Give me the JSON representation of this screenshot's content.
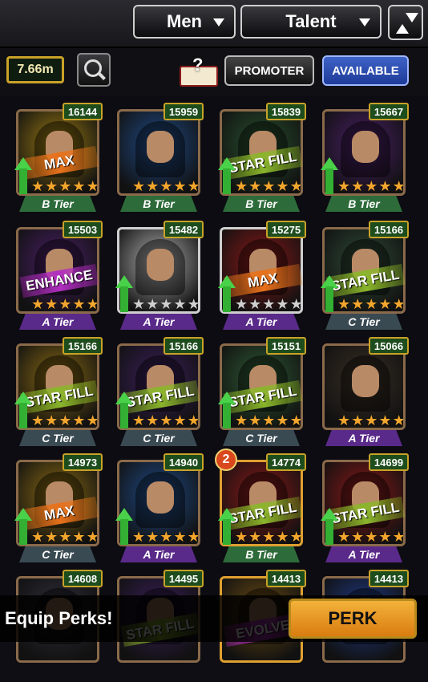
{
  "filters": {
    "gender": "Men",
    "sort": "Talent"
  },
  "toolbar": {
    "coins": "7.66m",
    "promoter_label": "PROMOTER",
    "available_label": "AVAILABLE"
  },
  "rows": [
    [
      {
        "power": "16144",
        "tier": "B Tier",
        "tier_class": "b",
        "banner": "MAX",
        "banner_class": "max",
        "arrow": true,
        "stars": 5,
        "gold": 5,
        "frame": "#8a6a4a",
        "bg": "#9a7a12"
      },
      {
        "power": "15959",
        "tier": "B Tier",
        "tier_class": "b",
        "banner": "",
        "banner_class": "",
        "arrow": false,
        "stars": 5,
        "gold": 5,
        "frame": "#8a6a4a",
        "bg": "#1f4a86"
      },
      {
        "power": "15839",
        "tier": "B Tier",
        "tier_class": "b",
        "banner": "STAR FILL",
        "banner_class": "starfill",
        "arrow": true,
        "stars": 5,
        "gold": 5,
        "frame": "#8a6a4a",
        "bg": "#28502e"
      },
      {
        "power": "15667",
        "tier": "B Tier",
        "tier_class": "b",
        "banner": "",
        "banner_class": "",
        "arrow": true,
        "stars": 5,
        "gold": 5,
        "frame": "#8a6a4a",
        "bg": "#4a1f66"
      }
    ],
    [
      {
        "power": "15503",
        "tier": "A Tier",
        "tier_class": "a",
        "banner": "ENHANCE",
        "banner_class": "enhance",
        "arrow": false,
        "stars": 5,
        "gold": 5,
        "frame": "#8a6a4a",
        "bg": "#4a1f66"
      },
      {
        "power": "15482",
        "tier": "A Tier",
        "tier_class": "a",
        "banner": "",
        "banner_class": "",
        "arrow": true,
        "stars": 5,
        "gold": 0,
        "frame": "#cfcfcf",
        "bg": "#b0b0b0"
      },
      {
        "power": "15275",
        "tier": "A Tier",
        "tier_class": "a",
        "banner": "MAX",
        "banner_class": "max",
        "arrow": true,
        "stars": 5,
        "gold": 0,
        "frame": "#cfcfcf",
        "bg": "#8a1818"
      },
      {
        "power": "15166",
        "tier": "C Tier",
        "tier_class": "c",
        "banner": "STAR FILL",
        "banner_class": "starfill",
        "arrow": true,
        "stars": 5,
        "gold": 5,
        "frame": "#8a6a4a",
        "bg": "#2e4a36"
      }
    ],
    [
      {
        "power": "15166",
        "tier": "C Tier",
        "tier_class": "c",
        "banner": "STAR FILL",
        "banner_class": "starfill",
        "arrow": true,
        "stars": 5,
        "gold": 5,
        "frame": "#8a6a4a",
        "bg": "#8a6a12"
      },
      {
        "power": "15166",
        "tier": "C Tier",
        "tier_class": "c",
        "banner": "STAR FILL",
        "banner_class": "starfill",
        "arrow": true,
        "stars": 5,
        "gold": 5,
        "frame": "#8a6a4a",
        "bg": "#3a1f5a"
      },
      {
        "power": "15151",
        "tier": "C Tier",
        "tier_class": "c",
        "banner": "STAR FILL",
        "banner_class": "starfill",
        "arrow": true,
        "stars": 5,
        "gold": 5,
        "frame": "#8a6a4a",
        "bg": "#2e5a34"
      },
      {
        "power": "15066",
        "tier": "A Tier",
        "tier_class": "a",
        "banner": "",
        "banner_class": "",
        "arrow": false,
        "stars": 5,
        "gold": 5,
        "frame": "#8a6a4a",
        "bg": "#3a2e24"
      }
    ],
    [
      {
        "power": "14973",
        "tier": "C Tier",
        "tier_class": "c",
        "banner": "MAX",
        "banner_class": "max",
        "arrow": true,
        "stars": 5,
        "gold": 5,
        "frame": "#8a6a4a",
        "bg": "#8a6a12"
      },
      {
        "power": "14940",
        "tier": "A Tier",
        "tier_class": "a",
        "banner": "",
        "banner_class": "",
        "arrow": true,
        "stars": 5,
        "gold": 5,
        "frame": "#8a6a4a",
        "bg": "#1f4a86"
      },
      {
        "power": "14774",
        "tier": "B Tier",
        "tier_class": "b",
        "banner": "STAR FILL",
        "banner_class": "starfill",
        "arrow": true,
        "stars": 5,
        "gold": 5,
        "frame": "#e0a030",
        "bg": "#8a1818",
        "badge": "2"
      },
      {
        "power": "14699",
        "tier": "A Tier",
        "tier_class": "a",
        "banner": "STAR FILL",
        "banner_class": "starfill",
        "arrow": true,
        "stars": 5,
        "gold": 5,
        "frame": "#8a6a4a",
        "bg": "#8a1818"
      }
    ],
    [
      {
        "power": "14608",
        "tier": "",
        "tier_class": "c",
        "banner": "",
        "banner_class": "",
        "arrow": false,
        "stars": 0,
        "gold": 0,
        "frame": "#8a6a4a",
        "bg": "#2e2e3a"
      },
      {
        "power": "14495",
        "tier": "",
        "tier_class": "c",
        "banner": "STAR FILL",
        "banner_class": "starfill",
        "arrow": false,
        "stars": 0,
        "gold": 0,
        "frame": "#8a6a4a",
        "bg": "#3a1f5a"
      },
      {
        "power": "14413",
        "tier": "",
        "tier_class": "c",
        "banner": "EVOLVE",
        "banner_class": "evolve",
        "arrow": false,
        "stars": 0,
        "gold": 0,
        "frame": "#e0a030",
        "bg": "#6a4a12"
      },
      {
        "power": "14413",
        "tier": "",
        "tier_class": "c",
        "banner": "",
        "banner_class": "",
        "arrow": false,
        "stars": 0,
        "gold": 0,
        "frame": "#8a6a4a",
        "bg": "#1f3a86"
      }
    ]
  ],
  "bottom": {
    "equip_text": "Equip Perks!",
    "perk_label": "PERK"
  }
}
